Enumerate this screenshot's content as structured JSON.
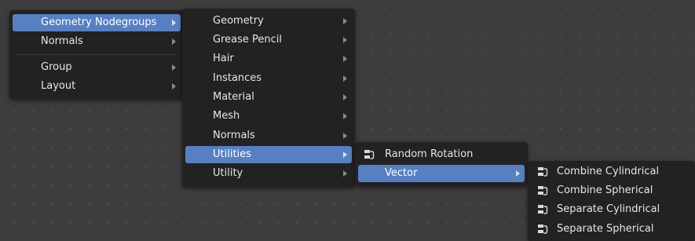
{
  "menu_add": {
    "items": [
      {
        "label": "Geometry Nodegroups",
        "submenu_arrow": true,
        "highlighted": true
      },
      {
        "label": "Normals",
        "submenu_arrow": true
      },
      {
        "label": "Group",
        "submenu_arrow": true
      },
      {
        "label": "Layout",
        "submenu_arrow": true
      }
    ]
  },
  "menu_nodegroups": {
    "items": [
      {
        "label": "Geometry",
        "submenu_arrow": true
      },
      {
        "label": "Grease Pencil",
        "submenu_arrow": true
      },
      {
        "label": "Hair",
        "submenu_arrow": true
      },
      {
        "label": "Instances",
        "submenu_arrow": true
      },
      {
        "label": "Material",
        "submenu_arrow": true
      },
      {
        "label": "Mesh",
        "submenu_arrow": true
      },
      {
        "label": "Normals",
        "submenu_arrow": true
      },
      {
        "label": "Utilities",
        "submenu_arrow": true,
        "highlighted": true
      },
      {
        "label": "Utility",
        "submenu_arrow": true
      }
    ]
  },
  "menu_utilities": {
    "items": [
      {
        "label": "Random Rotation",
        "icon": "node-group-icon"
      },
      {
        "label": "Vector",
        "submenu_arrow": true,
        "highlighted": true
      }
    ]
  },
  "menu_vector": {
    "items": [
      {
        "label": "Combine Cylindrical",
        "icon": "node-group-icon"
      },
      {
        "label": "Combine Spherical",
        "icon": "node-group-icon"
      },
      {
        "label": "Separate Cylindrical",
        "icon": "node-group-icon"
      },
      {
        "label": "Separate Spherical",
        "icon": "node-group-icon"
      }
    ]
  },
  "colors": {
    "background": "#3d3d3d",
    "menu": "#222222",
    "highlight": "#5680c2",
    "text": "#e6e6e6"
  }
}
